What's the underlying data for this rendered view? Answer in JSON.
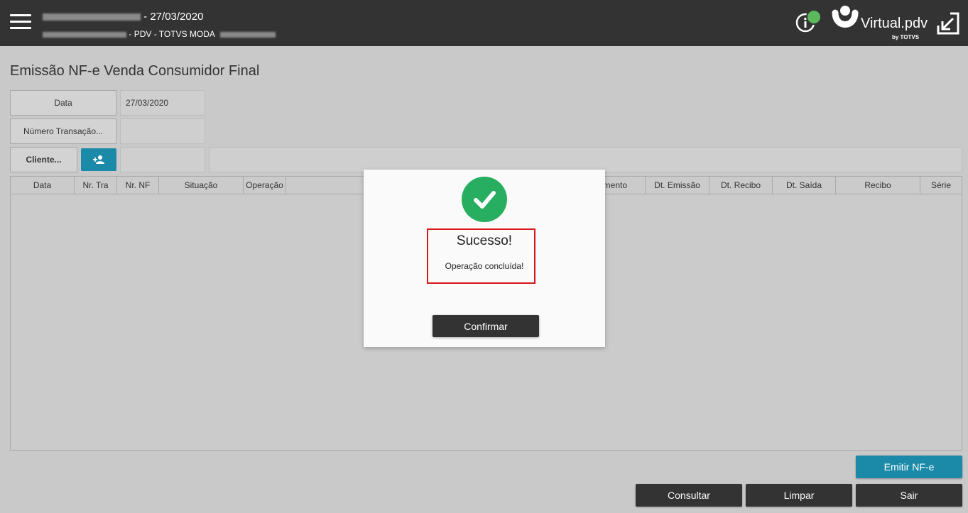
{
  "header": {
    "date": "27/03/2020",
    "subtitle": "PDV - TOTVS MODA",
    "logo_brand": "Virtual.pdv",
    "logo_by": "by TOTVS"
  },
  "page": {
    "title": "Emissão NF-e Venda Consumidor Final"
  },
  "form": {
    "data_label": "Data",
    "data_value": "27/03/2020",
    "numero_label": "Número Transação...",
    "numero_value": "",
    "cliente_label": "Cliente...",
    "cliente_value": ""
  },
  "table": {
    "columns": [
      "Data",
      "Nr. Tra",
      "Nr. NF",
      "Situação",
      "Operação",
      "",
      "amento",
      "Dt. Emissão",
      "Dt. Recibo",
      "Dt. Saída",
      "Recibo",
      "Série"
    ]
  },
  "buttons": {
    "emitir": "Emitir NF-e",
    "consultar": "Consultar",
    "limpar": "Limpar",
    "sair": "Sair"
  },
  "modal": {
    "title": "Sucesso!",
    "message": "Operação concluída!",
    "confirm": "Confirmar"
  },
  "colors": {
    "topbar": "#333333",
    "teal": "#1b8aa8",
    "success": "#27ae60",
    "highlight": "#d9161c"
  },
  "icons": [
    "menu-icon",
    "info-icon",
    "status-dot",
    "virtualpdv-logo",
    "exit-fullscreen-icon",
    "add-person-icon",
    "check-icon"
  ]
}
